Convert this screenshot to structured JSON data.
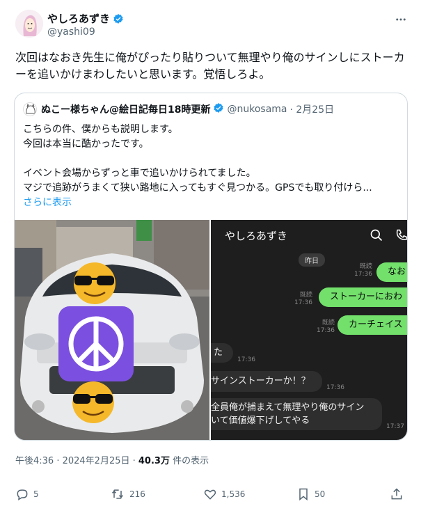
{
  "author": {
    "name": "やしろあずき",
    "handle": "@yashi09",
    "verified": true
  },
  "tweet": {
    "text": "次回はなおき先生に俺がぴったり貼りついて無理やり俺のサインしにストーカーを追いかけまわしたいと思います。覚悟しろよ。"
  },
  "quote": {
    "name": "ぬこー様ちゃん@絵日記毎日18時更新",
    "handle": "@nukosama",
    "date": "· 2月25日",
    "text": "こちらの件、僕からも説明します。\n今回は本当に酷かったです。\n\nイベント会場からずっと車で追いかけられてました。\nマジで追跡がうまくて狭い路地に入ってもすぐ見つかる。GPSでも取り付けら...",
    "show_more": "さらに表示"
  },
  "chat": {
    "title": "やしろあずき",
    "date_chip": "昨日",
    "out_messages": [
      {
        "text": "なお",
        "meta": "既読\n17:36"
      },
      {
        "text": "ストーカーにおわ",
        "meta": "既読\n17:36"
      },
      {
        "text": "カーチェイス",
        "meta": "既読\n17:36"
      }
    ],
    "in_messages": [
      {
        "text": "た",
        "time": "17:36"
      },
      {
        "text": "サインストーカーか！？",
        "time": "17:36"
      },
      {
        "text": "全員俺が捕まえて無理やり俺のサイン\nいて価値爆下げしてやる",
        "time": "17:37"
      }
    ]
  },
  "footer": {
    "time": "午後4:36 · 2024年2月25日 · ",
    "views_count": "40.3万",
    "views_label": " 件の表示"
  },
  "actions": {
    "replies": "5",
    "retweets": "216",
    "likes": "1,536",
    "bookmarks": "50"
  },
  "colors": {
    "verified": "#1d9bf0",
    "link": "#1d9bf0",
    "chat_bubble_out": "#72e06b",
    "emoji_tile": "#7b4fe0"
  }
}
